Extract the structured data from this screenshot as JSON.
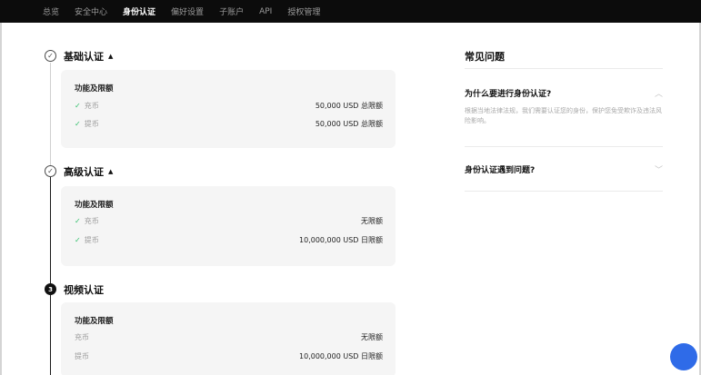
{
  "nav": {
    "items": [
      "总览",
      "安全中心",
      "身份认证",
      "偏好设置",
      "子账户",
      "API",
      "授权管理"
    ],
    "active_index": 2
  },
  "steps": [
    {
      "title": "基础认证",
      "caret": "▲",
      "card_title": "功能及限额",
      "rows": [
        {
          "label": "充币",
          "value": "50,000 USD 总限额"
        },
        {
          "label": "提币",
          "value": "50,000 USD 总限额"
        }
      ]
    },
    {
      "title": "高级认证",
      "caret": "▲",
      "card_title": "功能及限额",
      "rows": [
        {
          "label": "充币",
          "value": "无限额"
        },
        {
          "label": "提币",
          "value": "10,000,000 USD 日限额"
        }
      ]
    },
    {
      "title": "视频认证",
      "number": "3",
      "card_title": "功能及限额",
      "rows": [
        {
          "label": "充币",
          "value": "无限额"
        },
        {
          "label": "提币",
          "value": "10,000,000 USD 日限额"
        }
      ]
    }
  ],
  "faq": {
    "title": "常见问题",
    "items": [
      {
        "question": "为什么要进行身份认证?",
        "answer": "根据当地法律法规，我们需要认证您的身份，保护您免受欺诈及违法风险影响。"
      },
      {
        "question": "身份认证遇到问题?"
      }
    ]
  },
  "colors": {
    "nav_bg": "#0c0c0c",
    "check_green": "#2fbf6a",
    "card_bg": "#f5f5f5",
    "help_blue": "#2f6be8"
  }
}
